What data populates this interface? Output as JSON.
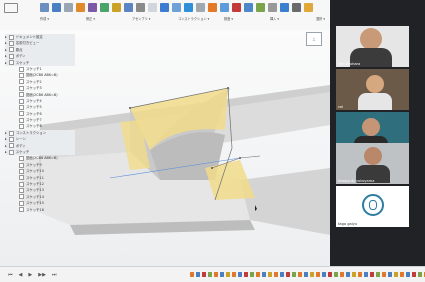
{
  "toolbar": {
    "labels": [
      "作成 ▾",
      "修正 ▾",
      "アセンブリ ▾",
      "コンストラクション ▾",
      "検査 ▾",
      "挿入 ▾",
      "選択 ▾"
    ],
    "tool_colors": [
      "#6b8fbf",
      "#4a7fc1",
      "#9aa6b2",
      "#e08a2c",
      "#7c5aa6",
      "#4aa36b",
      "#c9a227",
      "#5b84c4",
      "#8a8a8a",
      "#d0d6dc",
      "#3e7bd1",
      "#6fa0d8",
      "#2f8fd8",
      "#a0a8b0",
      "#e27a2a",
      "#5e9cd9",
      "#c23b3b",
      "#4d88c9",
      "#7ba34a",
      "#999999",
      "#3b7fd0",
      "#6a6a6a",
      "#e0a83a"
    ]
  },
  "browser": {
    "rows": [
      {
        "label": "ドキュメント設定",
        "indent": 0,
        "header": true
      },
      {
        "label": "名前付きビュー",
        "indent": 0,
        "header": true
      },
      {
        "label": "原点",
        "indent": 0,
        "header": true
      },
      {
        "label": "ボディ",
        "indent": 0,
        "header": true
      },
      {
        "label": "スケッチ",
        "indent": 0,
        "header": true
      },
      {
        "label": "スケッチ1",
        "indent": 2
      },
      {
        "label": "図面(2CB6 ABK=B)",
        "indent": 2
      },
      {
        "label": "スケッチ2",
        "indent": 2
      },
      {
        "label": "スケッチ3",
        "indent": 2
      },
      {
        "label": "図面(2CB6 ABK=B)",
        "indent": 2
      },
      {
        "label": "スケッチ4",
        "indent": 2
      },
      {
        "label": "スケッチ5",
        "indent": 2
      },
      {
        "label": "スケッチ6",
        "indent": 2
      },
      {
        "label": "スケッチ7",
        "indent": 2
      },
      {
        "label": "スケッチ8",
        "indent": 2
      },
      {
        "label": "コンストラクション",
        "indent": 0,
        "header": true
      },
      {
        "label": "シーン",
        "indent": 0,
        "header": true
      },
      {
        "label": "ボディ",
        "indent": 0,
        "header": true
      },
      {
        "label": "スケッチ",
        "indent": 0,
        "header": true
      },
      {
        "label": "図面(2CB6 ABK=B)",
        "indent": 2
      },
      {
        "label": "スケッチ9",
        "indent": 2
      },
      {
        "label": "スケッチ10",
        "indent": 2
      },
      {
        "label": "スケッチ11",
        "indent": 2
      },
      {
        "label": "スケッチ12",
        "indent": 2
      },
      {
        "label": "スケッチ13",
        "indent": 2
      },
      {
        "label": "スケッチ14",
        "indent": 2
      },
      {
        "label": "スケッチ15",
        "indent": 2
      },
      {
        "label": "スケッチ16",
        "indent": 2
      }
    ]
  },
  "participants": [
    {
      "name": "Yuri Uruhara",
      "bg": "#e6e6e6",
      "skin": "#c89a78",
      "shirt": "#3b3b3b"
    },
    {
      "name": "cel",
      "bg": "#6b5a48",
      "skin": "#d6a880",
      "shirt": "#e6e6e6"
    },
    {
      "name": "tago",
      "bg": "#2f6f7d",
      "skin": "#c59575",
      "shirt": "#2a2a2a"
    },
    {
      "name": "tomoyuki yokoyama",
      "bg": "#bfc2c4",
      "skin": "#b9876a",
      "shirt": "#3a3a3a"
    },
    {
      "name": "tago gaiyu",
      "bg": "#ffffff",
      "skin": "#ffffff",
      "shirt": "#2c7da0"
    }
  ],
  "nav_cube_label": "上",
  "timeline": {
    "controls": [
      "⏮",
      "◀",
      "▶",
      "▶▶",
      "⏭"
    ],
    "item_colors": [
      "#e07a2a",
      "#4a7fc1",
      "#c23b3b",
      "#7ba34a",
      "#e07a2a",
      "#4a7fc1",
      "#c9a227",
      "#e07a2a",
      "#4a7fc1",
      "#c23b3b",
      "#7ba34a",
      "#e07a2a",
      "#4a7fc1",
      "#c9a227",
      "#e07a2a",
      "#4a7fc1",
      "#c23b3b",
      "#7ba34a",
      "#e07a2a",
      "#4a7fc1",
      "#c9a227",
      "#e07a2a",
      "#4a7fc1",
      "#c23b3b",
      "#7ba34a",
      "#e07a2a",
      "#4a7fc1",
      "#c9a227",
      "#e07a2a",
      "#4a7fc1",
      "#c23b3b",
      "#7ba34a",
      "#e07a2a",
      "#4a7fc1",
      "#c9a227",
      "#e07a2a",
      "#4a7fc1",
      "#c23b3b",
      "#7ba34a",
      "#e07a2a",
      "#4a7fc1",
      "#c9a227"
    ]
  }
}
